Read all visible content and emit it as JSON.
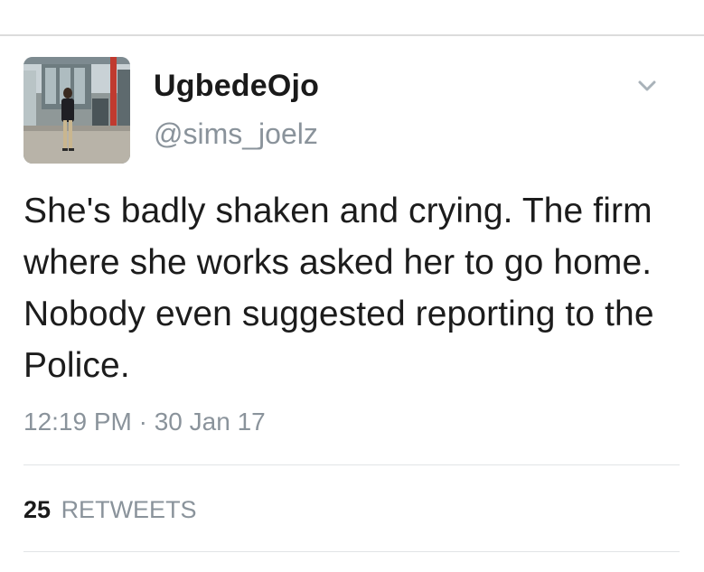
{
  "tweet": {
    "display_name": "UgbedeOjo",
    "handle": "@sims_joelz",
    "text": "She's badly shaken and crying. The firm where she works asked her to go home. Nobody even suggested reporting to the Police.",
    "timestamp": "12:19 PM · 30 Jan 17",
    "avatar_icon": "profile-photo-airport",
    "menu_icon": "chevron-down-icon"
  },
  "stats": {
    "retweet_count": "25",
    "retweet_label": "RETWEETS"
  },
  "colors": {
    "text": "#1c1c1c",
    "secondary": "#8a939b",
    "divider": "#e1e4e6"
  }
}
